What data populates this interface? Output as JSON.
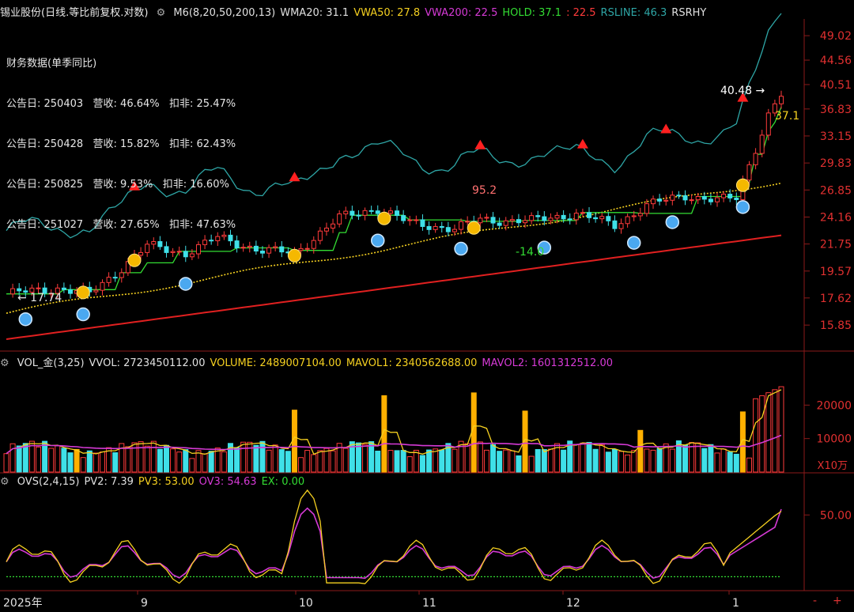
{
  "header": {
    "title": "锡业股份(日线.等比前复权.对数)",
    "indicators": [
      {
        "text": "M6(8,20,50,200,13)",
        "color": "#e0e0e0"
      },
      {
        "text": "WMA20: 31.1",
        "color": "#e0e0e0"
      },
      {
        "text": "VWA50: 27.8",
        "color": "#f5d020"
      },
      {
        "text": "VWA200: 22.5",
        "color": "#d63ad6"
      },
      {
        "text": "HOLD: 37.1",
        "color": "#33dd33"
      },
      {
        "text": ": 22.5",
        "color": "#ff3b3b"
      },
      {
        "text": "RSLINE: 46.3",
        "color": "#2ea6a6"
      },
      {
        "text": "RSRHY",
        "color": "#e0e0e0"
      }
    ]
  },
  "financials": {
    "title": "财务数据(单季同比)",
    "rows": [
      "公告日: 250403   营收: 46.64%   扣非: 25.47%",
      "公告日: 250428   营收: 15.82%   扣非: 62.43%",
      "公告日: 250825   营收: 9.53%   扣非: 16.60%",
      "公告日: 251027   营收: 27.65%   扣非: 47.63%"
    ]
  },
  "volume_header": [
    {
      "text": "VOL_金(3,25)",
      "color": "#e0e0e0"
    },
    {
      "text": "VVOL: 2723450112.00",
      "color": "#e0e0e0"
    },
    {
      "text": "VOLUME: 2489007104.00",
      "color": "#f5d020"
    },
    {
      "text": "MAVOL1: 2340562688.00",
      "color": "#f5d020"
    },
    {
      "text": "MAVOL2: 1601312512.00",
      "color": "#d63ad6"
    }
  ],
  "ovs_header": [
    {
      "text": "OVS(2,4,15)",
      "color": "#e0e0e0"
    },
    {
      "text": "PV2: 7.39",
      "color": "#e0e0e0"
    },
    {
      "text": "PV3: 53.00",
      "color": "#f5d020"
    },
    {
      "text": "OV3: 54.63",
      "color": "#d63ad6"
    },
    {
      "text": "EX: 0.00",
      "color": "#33dd33"
    }
  ],
  "chart_data": {
    "type": "candlestick",
    "price_axis_ticks": [
      "49.02",
      "44.56",
      "40.51",
      "36.83",
      "33.15",
      "29.83",
      "26.85",
      "24.16",
      "21.75",
      "19.57",
      "17.62",
      "15.85"
    ],
    "volume_axis_ticks": [
      "20000",
      "10000"
    ],
    "volume_unit": "X10万",
    "ovs_axis_ticks": [
      "50.00"
    ],
    "x_labels": [
      "2025年",
      "9",
      "10",
      "11",
      "12",
      "1"
    ],
    "annotations": [
      "17.74",
      "95.2",
      "-14.0",
      "40.48",
      "37.1"
    ],
    "hold_value": 37.1,
    "last_high": 40.48,
    "start_low": 17.74,
    "series": [
      {
        "name": "WMA20",
        "value": 31.1,
        "color": "#2ea6a6"
      },
      {
        "name": "VWA50",
        "value": 27.8,
        "color": "#f5d020"
      },
      {
        "name": "VWA200",
        "value": 22.5,
        "color": "#e02020"
      },
      {
        "name": "HOLD",
        "value": 37.1,
        "color": "#33dd33"
      }
    ],
    "volume_series": [
      {
        "name": "VOLUME",
        "value": 2489007104
      },
      {
        "name": "MAVOL1",
        "value": 2340562688
      },
      {
        "name": "MAVOL2",
        "value": 1601312512
      }
    ],
    "ovs_series": [
      {
        "name": "PV2",
        "value": 7.39
      },
      {
        "name": "PV3",
        "value": 53.0
      },
      {
        "name": "OV3",
        "value": 54.63
      },
      {
        "name": "EX",
        "value": 0.0
      }
    ]
  }
}
